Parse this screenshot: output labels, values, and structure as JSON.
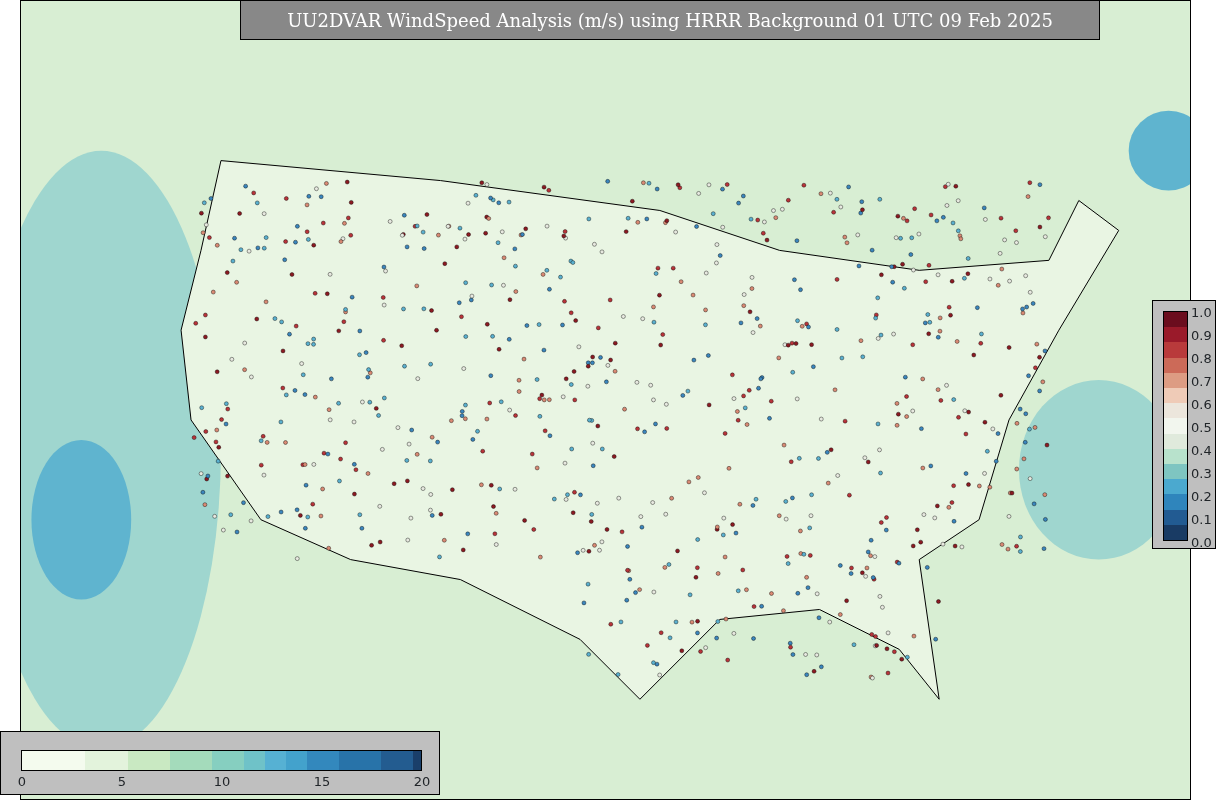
{
  "title": "UU2DVAR WindSpeed Analysis (m/s) using HRRR Background 01 UTC 09 Feb 2025",
  "map": {
    "kind": "wind-speed-map"
  },
  "colorbar_right": {
    "ticks": [
      "1.0",
      "0.9",
      "0.8",
      "0.7",
      "0.6",
      "0.5",
      "0.4",
      "0.3",
      "0.2",
      "0.1",
      "0.0"
    ]
  },
  "colorbar_bottom": {
    "ticks": [
      "0",
      "5",
      "10",
      "15",
      "20"
    ]
  }
}
